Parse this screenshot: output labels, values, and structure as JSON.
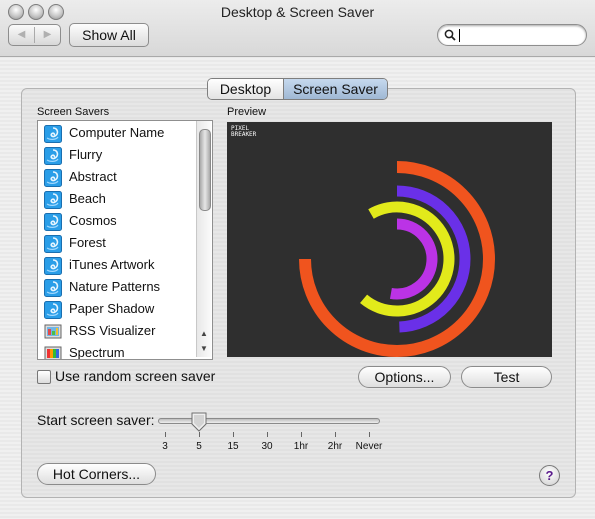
{
  "window": {
    "title": "Desktop & Screen Saver"
  },
  "toolbar": {
    "back_icon": "back-arrow-icon",
    "forward_icon": "forward-arrow-icon",
    "show_all_label": "Show All",
    "search": {
      "value": "",
      "placeholder": ""
    }
  },
  "tabs": [
    {
      "label": "Desktop",
      "selected": false
    },
    {
      "label": "Screen Saver",
      "selected": true
    }
  ],
  "screen_savers": {
    "header": "Screen Savers",
    "items": [
      {
        "label": "Computer Name",
        "icon": "swirl-icon"
      },
      {
        "label": "Flurry",
        "icon": "swirl-icon"
      },
      {
        "label": "Abstract",
        "icon": "swirl-icon"
      },
      {
        "label": "Beach",
        "icon": "swirl-icon"
      },
      {
        "label": "Cosmos",
        "icon": "swirl-icon"
      },
      {
        "label": "Forest",
        "icon": "swirl-icon"
      },
      {
        "label": "iTunes Artwork",
        "icon": "swirl-icon"
      },
      {
        "label": "Nature Patterns",
        "icon": "swirl-icon"
      },
      {
        "label": "Paper Shadow",
        "icon": "swirl-icon"
      },
      {
        "label": "RSS Visualizer",
        "icon": "rss-visualizer-icon"
      },
      {
        "label": "Spectrum",
        "icon": "spectrum-icon"
      }
    ]
  },
  "preview": {
    "header": "Preview",
    "logo_text": "PIXEL\nBREAKER"
  },
  "random_screen_saver": {
    "label": "Use random screen saver",
    "checked": false
  },
  "buttons": {
    "options": "Options...",
    "test": "Test",
    "hot_corners": "Hot Corners..."
  },
  "start_slider": {
    "label": "Start screen saver:",
    "ticks": [
      "3",
      "5",
      "15",
      "30",
      "1hr",
      "2hr",
      "Never"
    ],
    "selected": "5"
  },
  "help": {
    "label": "?"
  },
  "colors": {
    "ring_orange": "#f0541e",
    "ring_blue": "#6a30e8",
    "ring_yellow": "#e2ea1b",
    "ring_purple": "#bb33e6",
    "preview_bg": "#2f2f2f",
    "tab_selected": "#b3c9e2"
  }
}
